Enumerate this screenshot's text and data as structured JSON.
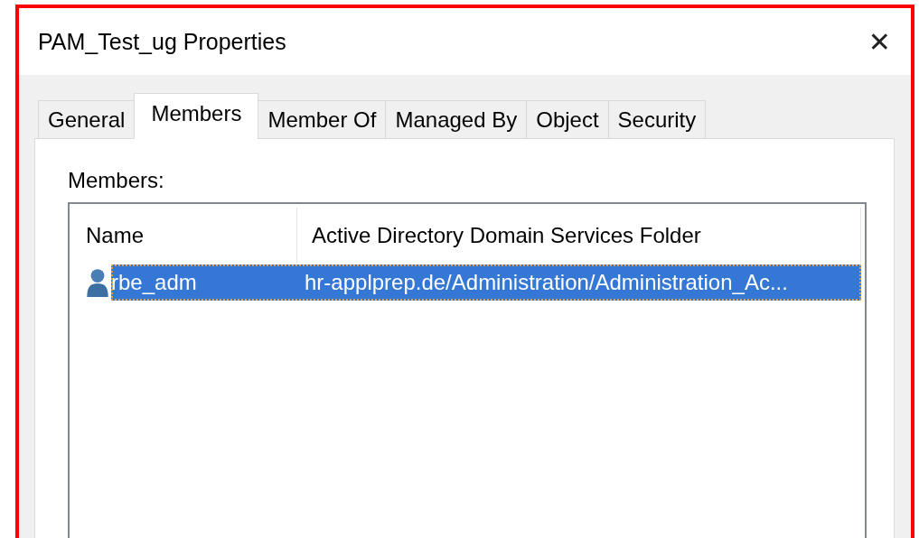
{
  "window": {
    "title": "PAM_Test_ug Properties",
    "close": "✕"
  },
  "tabs": [
    {
      "label": "General",
      "selected": false
    },
    {
      "label": "Members",
      "selected": true
    },
    {
      "label": "Member Of",
      "selected": false
    },
    {
      "label": "Managed By",
      "selected": false
    },
    {
      "label": "Object",
      "selected": false
    },
    {
      "label": "Security",
      "selected": false
    }
  ],
  "members_label": "Members:",
  "list": {
    "columns": [
      "Name",
      "Active Directory Domain Services Folder"
    ],
    "rows": [
      {
        "name": "rbe_adm",
        "folder": "hr-applprep.de/Administration/Administration_Ac...",
        "selected": true
      }
    ]
  }
}
